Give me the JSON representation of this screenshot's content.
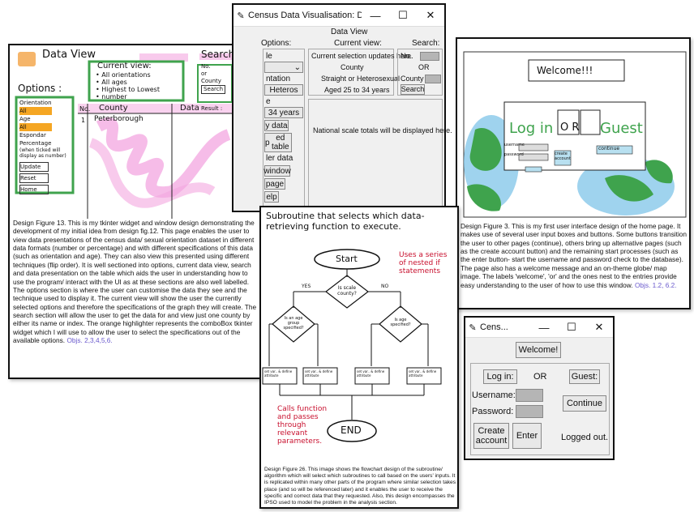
{
  "card_tl": {
    "sketch": {
      "data_view": "Data View",
      "search": "Search",
      "current_view": "Current view:",
      "bullets": [
        "• All orientations",
        "• All ages",
        "• Highest to Lowest",
        "• number"
      ],
      "options": "Options :",
      "orientation": "Orientation",
      "all": "All",
      "age": "Age",
      "all2": "All",
      "espondar": "Espondar",
      "percentage": "Percentage",
      "pct_note": "(when ticked will display as number)",
      "update": "Update",
      "reset": "Reset",
      "home": "Home",
      "no": "No.",
      "or": "or",
      "county_small": "County",
      "search_btn": "Search",
      "result": "Result :",
      "col_no": "No.",
      "col_county": "County",
      "col_data": "Data",
      "row_no": "1",
      "row_county": "Peterborough"
    },
    "caption": "Design Figure 13. This is my tkinter widget and window design demonstrating the development of my initial idea from design fig.12. This page enables the user to view data presentations of the census data/ sexual orientation dataset in different data formats (number or percentage) and with different specifications of this data (such as orientation and age). They can also view this presented using different techniques (flip order). It is well sectioned into options, current data view, search and data presentation on the table which aids the user in understanding how to use the program/ interact with the UI as at these sections are also well labelled. The options section is where the user can customise the data they see and the technique used to display it. The current view will show the user the currently selected options and therefore the specifications of the graph they will create. The search section will allow the user to get the data for and view just one county by either its name or index. The orange highlighter represents the comboBox tkinter widget which I will use to allow the user to select the specifications out of the available options.",
    "caption_obj": "Objs. 2,3,4,5,6."
  },
  "card_tc": {
    "window_title": "Census Data Visualisation: Data View Page",
    "header": "Data View",
    "options_label": "Options:",
    "current_view_label": "Current view:",
    "search_label": "Search:",
    "left_labels": [
      "le",
      "ntation",
      "Heteros",
      "e",
      "34 years"
    ],
    "left_buttons": [
      "y data",
      "p",
      "ed table",
      "ler data",
      "window",
      "page",
      "elp"
    ],
    "current_lines": [
      "Current selection updates here.",
      "County",
      "Straight or Heterosexual",
      "Aged 25 to 34 years"
    ],
    "national": "National scale totals will be displayed here.",
    "no_label": "No.",
    "or_label": "OR",
    "county_label": "County",
    "search_button": "Search"
  },
  "card_tr": {
    "welcome": "Welcome!!!",
    "login": "Log in",
    "or": "O R",
    "guest": "Guest",
    "continue": "continue",
    "create": "create account",
    "username": "username",
    "password": "password",
    "caption": "Design Figure 3. This is my first user interface design of the home page. It makes use of several user input boxes and buttons. Some buttons transition the user to other pages (continue), others bring up alternative pages (such as the create account button) and the remaining start processes (such as the enter button- start the username and password check to the database). The page also has a welcome message and an on-theme globe/ map image. The labels 'welcome', 'or' and the ones nest to the entries provide easy understanding to the user of how to use this window.",
    "caption_obj": "Objs. 1.2, 6.2."
  },
  "card_bc": {
    "title": "Subroutine that selects which data-retrieving function to execute.",
    "start": "Start",
    "end": "END",
    "note_nested": "Uses a series of nested if statements",
    "q1": "Is scale county?",
    "yes": "YES",
    "no": "NO",
    "q2": "Is an age group specified?",
    "q3": "Is age specified?",
    "n": "N",
    "y": "Y",
    "box": "set var.. & define attribute",
    "calls": "Calls function and passes through relevant parameters.",
    "caption": "Design Figure 26. This image shows the flowchart design of the subroutine/ algorithm which will select which subroutines to call based on the users' inputs. It is replicated within many other parts of the program where similar selection takes place (and so will be referenced later) and it enables the user to receive the specific and correct data that they requested. Also, this design encompasses the IPSO used to model the problem in the analysis section."
  },
  "card_br": {
    "window_title": "Cens...",
    "welcome": "Welcome!",
    "login": "Log in:",
    "or": "OR",
    "guest": "Guest:",
    "username": "Username:",
    "password": "Password:",
    "continue": "Continue",
    "create": "Create account",
    "enter": "Enter",
    "logged_out": "Logged out."
  },
  "colors": {
    "pink": "#f3a6e0",
    "green": "#3fa34d",
    "orange": "#f5a623",
    "caption_obj": "#6a5acd",
    "red_note": "#c8102e"
  }
}
